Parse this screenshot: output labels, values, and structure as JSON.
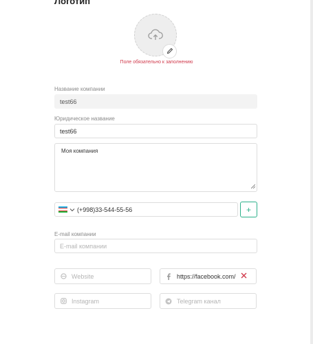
{
  "logo": {
    "title": "Логотип",
    "upload_icon": "cloud-upload-icon",
    "edit_icon": "pencil-icon",
    "error": "Поле обязательно к заполнению"
  },
  "company_name": {
    "label": "Название компании",
    "value": "test66"
  },
  "legal_name": {
    "label": "Юридическое название",
    "value": "test66"
  },
  "description": {
    "value": "Моя компания"
  },
  "phone": {
    "country_flag": "uz-flag-icon",
    "value": "(+998)33-544-55-56",
    "add_label": "+"
  },
  "email": {
    "label": "E-mail компании",
    "placeholder": "E-mail компании"
  },
  "socials": {
    "website": {
      "icon": "globe-icon",
      "placeholder": "Website"
    },
    "facebook": {
      "icon": "facebook-icon",
      "value": "https://facebook.com/",
      "clear_icon": "close-icon"
    },
    "instagram": {
      "icon": "instagram-icon",
      "placeholder": "Instagram"
    },
    "telegram": {
      "icon": "telegram-icon",
      "placeholder": "Telegram канал"
    }
  },
  "colors": {
    "accent": "#2bb08a",
    "error": "#d0394b",
    "clear": "#d0394b"
  }
}
